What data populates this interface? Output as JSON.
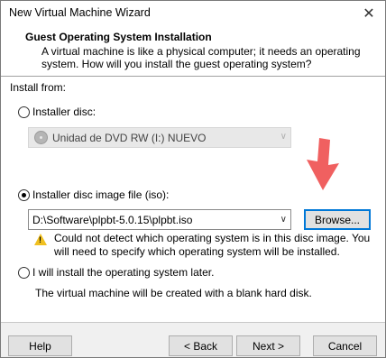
{
  "window": {
    "title": "New Virtual Machine Wizard"
  },
  "header": {
    "title": "Guest Operating System Installation",
    "description": "A virtual machine is like a physical computer; it needs an operating system. How will you install the guest operating system?"
  },
  "install": {
    "install_from_label": "Install from:",
    "installer_disc": {
      "label": "Installer disc:",
      "selected": false,
      "drive_value": "Unidad de DVD RW (I:) NUEVO"
    },
    "installer_iso": {
      "label": "Installer disc image file (iso):",
      "selected": true,
      "path_value": "D:\\Software\\plpbt-5.0.15\\plpbt.iso",
      "browse_label": "Browse...",
      "warning": "Could not detect which operating system is in this disc image. You will need to specify which operating system will be installed."
    },
    "install_later": {
      "label": "I will install the operating system later.",
      "selected": false,
      "description": "The virtual machine will be created with a blank hard disk."
    }
  },
  "footer": {
    "help_label": "Help",
    "back_label": "< Back",
    "next_label": "Next >",
    "cancel_label": "Cancel"
  },
  "colors": {
    "annotation_arrow": "#f06060",
    "warning": "#f0c020",
    "focus_border": "#0078d7"
  },
  "icons": {
    "close": "close-icon",
    "disc": "disc-icon",
    "warning": "warning-icon",
    "annotation": "arrow-down-annotation"
  }
}
